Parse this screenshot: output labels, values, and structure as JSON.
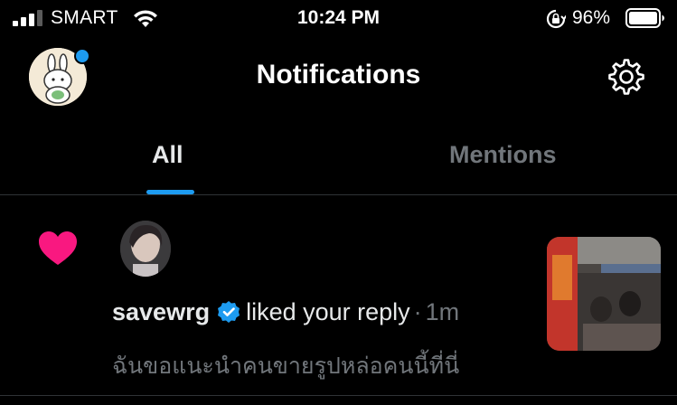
{
  "status_bar": {
    "carrier": "SMART",
    "time": "10:24 PM",
    "battery_percent": "96%",
    "signal_bars": 3,
    "icons": [
      "signal-icon",
      "wifi-icon",
      "rotation-lock-icon",
      "battery-icon"
    ]
  },
  "header": {
    "title": "Notifications",
    "has_unread_dot": true,
    "icons": [
      "avatar",
      "gear-icon"
    ]
  },
  "tabs": [
    {
      "label": "All",
      "selected": true
    },
    {
      "label": "Mentions",
      "selected": false
    }
  ],
  "notifications": [
    {
      "type_icon": "heart-icon",
      "username": "savewrg",
      "verified": true,
      "action": "liked your reply",
      "separator": "·",
      "time_ago": "1m",
      "reply_text": "ฉันขอแนะนำคนขายรูปหล่อคนนี้ที่นี่"
    }
  ],
  "colors": {
    "background": "#000000",
    "accent": "#1d9bf0",
    "heart": "#f91880",
    "muted_text": "#71767b"
  }
}
